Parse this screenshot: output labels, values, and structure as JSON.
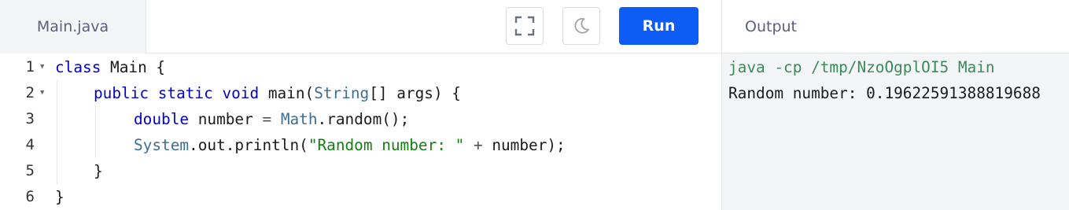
{
  "editor": {
    "filename": "Main.java",
    "lines": [
      {
        "num": "1",
        "fold": true
      },
      {
        "num": "2",
        "fold": true
      },
      {
        "num": "3",
        "fold": false
      },
      {
        "num": "4",
        "fold": false
      },
      {
        "num": "5",
        "fold": false
      },
      {
        "num": "6",
        "fold": false
      }
    ],
    "code": {
      "l1_kw": "class",
      "l1_rest": " Main {",
      "l2_kw": "public static void",
      "l2_mid": " main(",
      "l2_type": "String",
      "l2_rest": "[] args) {",
      "l3_kw": "double",
      "l3_mid": " number ",
      "l3_op": "=",
      "l3_sp": " ",
      "l3_type": "Math",
      "l3_rest": ".random();",
      "l4_type": "System",
      "l4_mid": ".out.println(",
      "l4_str": "\"Random number: \"",
      "l4_sp": " ",
      "l4_op": "+",
      "l4_rest": " number);",
      "l5": "}",
      "l6": "}"
    }
  },
  "toolbar": {
    "fullscreen_icon": "fullscreen-icon",
    "theme_icon": "moon-icon",
    "run_label": "Run"
  },
  "output": {
    "header": "Output",
    "command": "java -cp /tmp/NzoOgplOI5 Main",
    "result": "Random number: 0.19622591388819688"
  },
  "colors": {
    "accent": "#0d5cf5",
    "keyword": "#0000cc",
    "type": "#3f6e94",
    "string": "#148014",
    "command": "#3a8a5a"
  }
}
